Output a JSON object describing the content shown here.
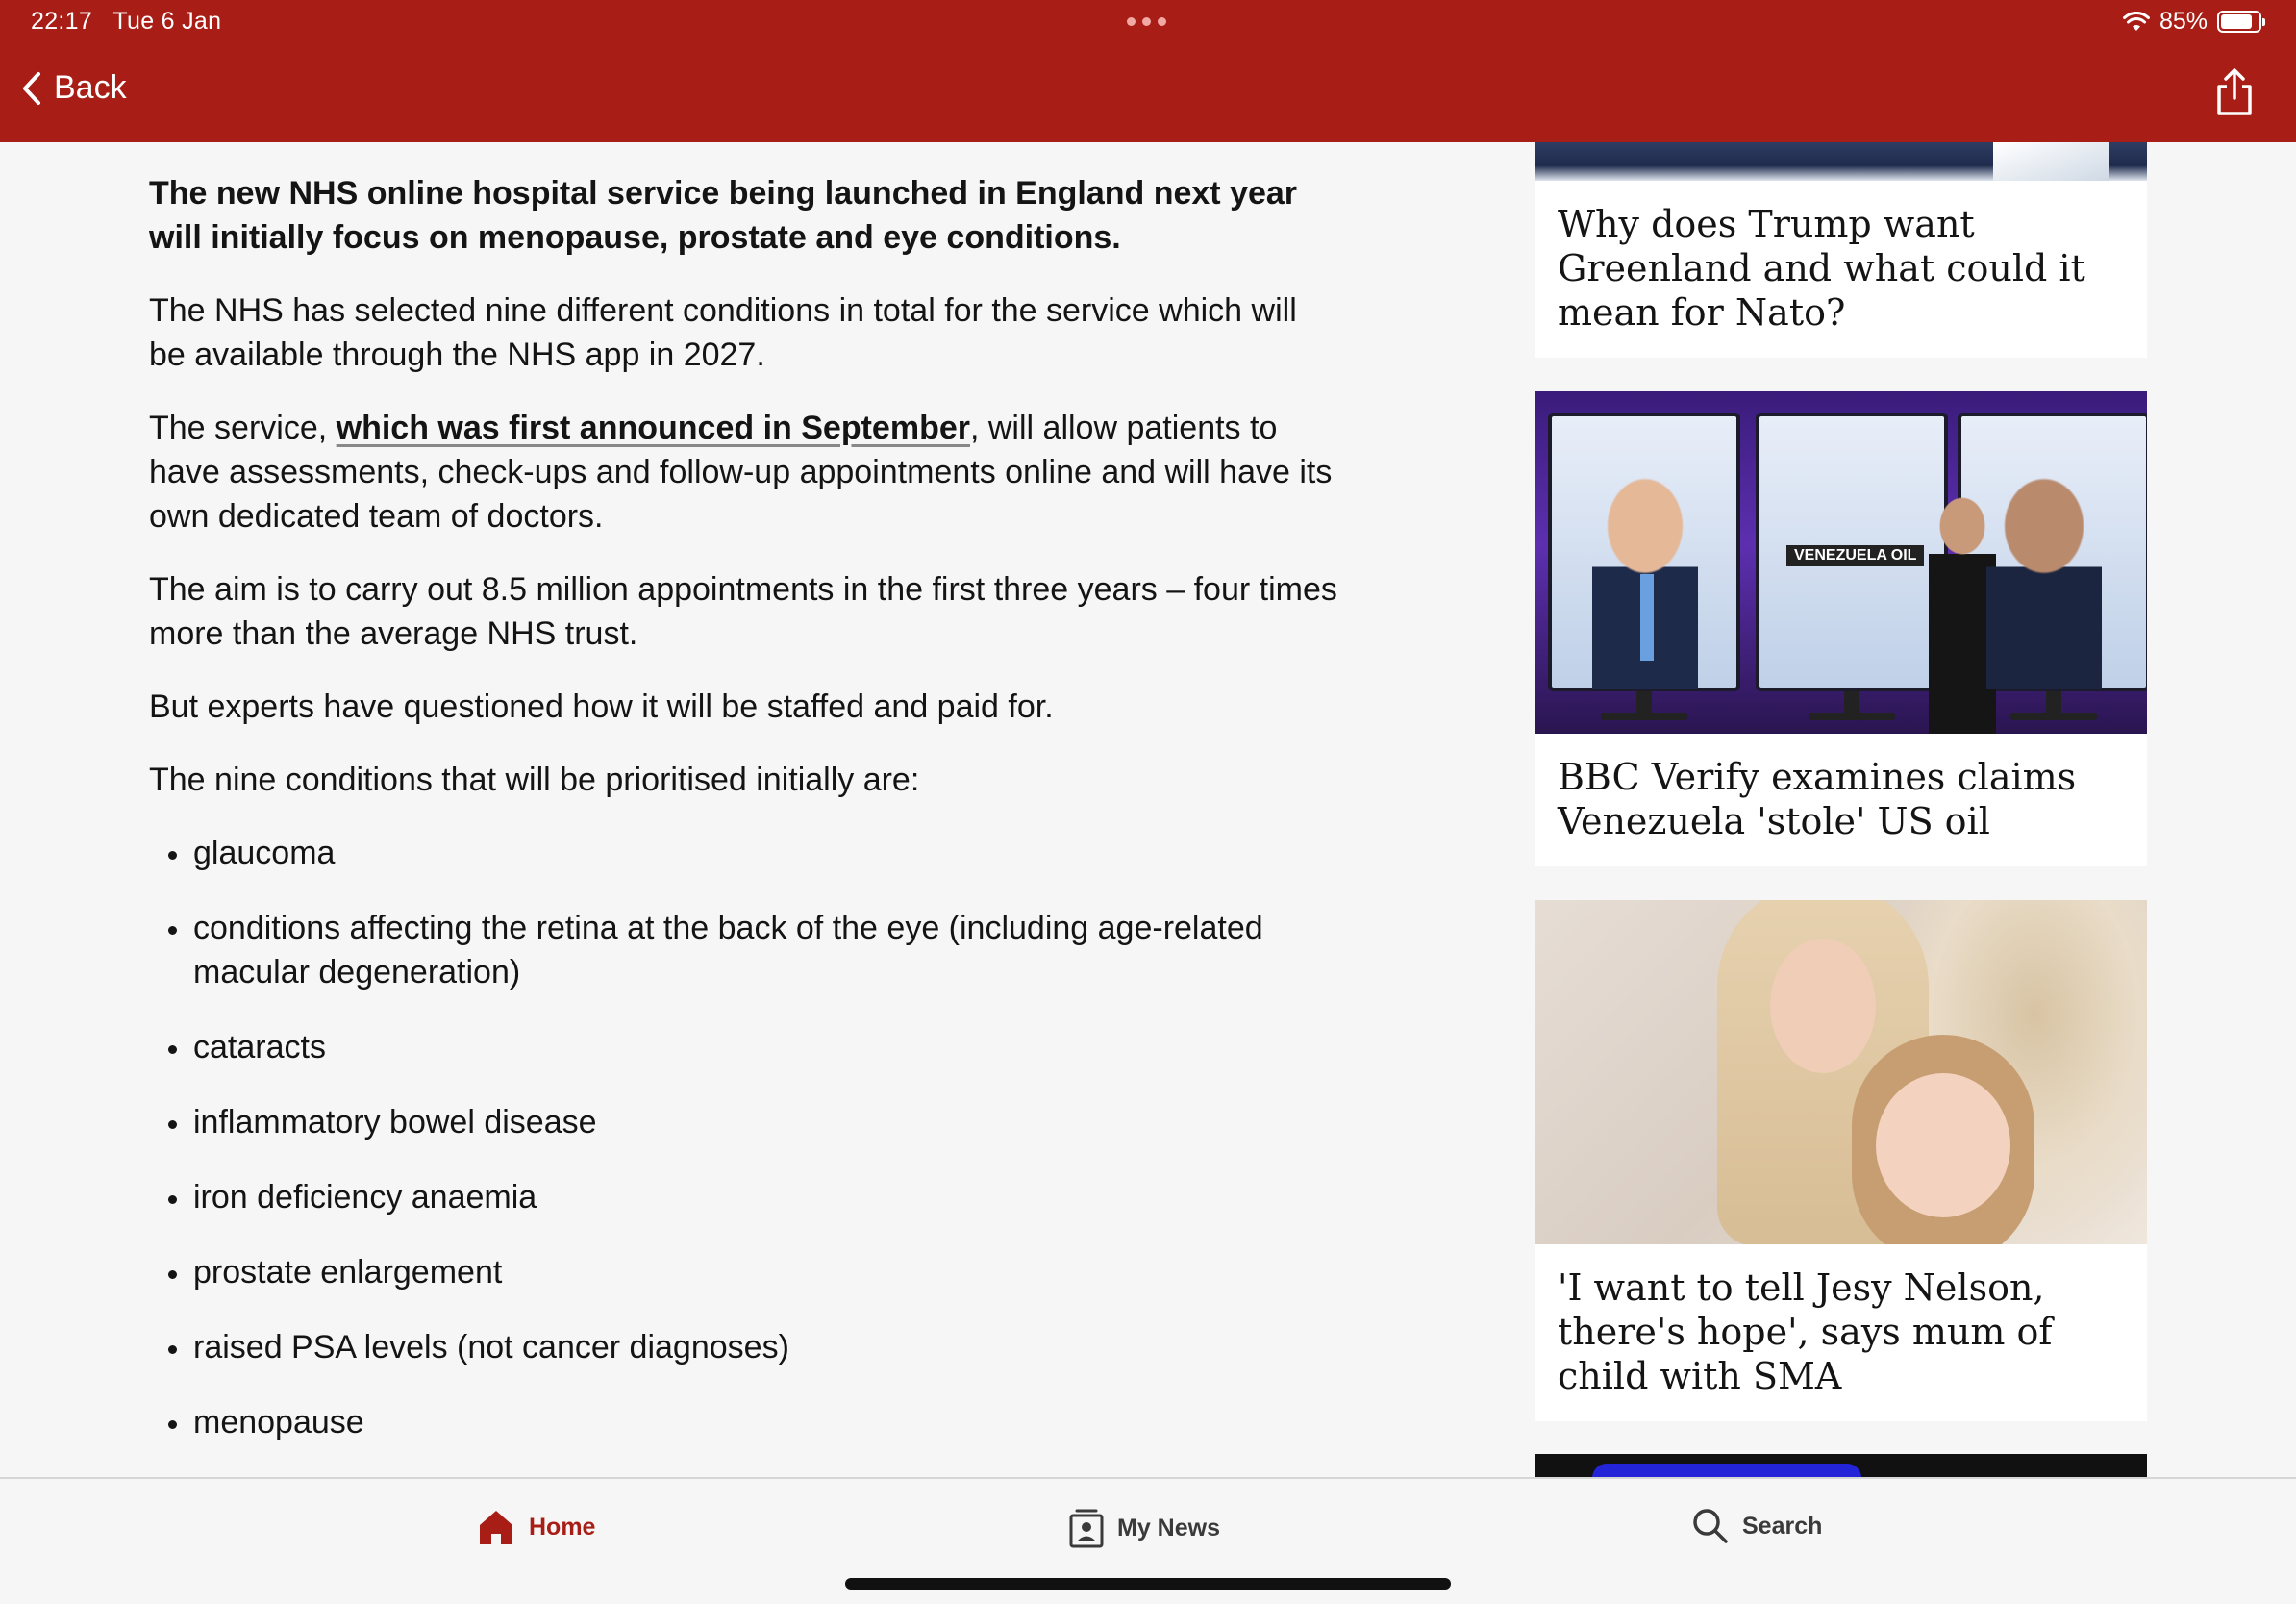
{
  "status_bar": {
    "time": "22:17",
    "date": "Tue 6 Jan",
    "battery": "85%",
    "battery_level": 0.85
  },
  "header": {
    "back_label": "Back",
    "bg_color": "#a81e16"
  },
  "article": {
    "lead": "The new NHS online hospital service being launched in England next year will initially focus on menopause, prostate and eye conditions.",
    "p1": "The NHS has selected nine different conditions in total for the service which will be available through the NHS app in 2027.",
    "p2_before": "The service, ",
    "p2_link": "which was first announced in September",
    "p2_after": ", will allow patients to have assessments, check-ups and follow-up appointments online and will have its own dedicated team of doctors.",
    "p3": "The aim is to carry out 8.5 million appointments in the first three years – four times more than the average NHS trust.",
    "p4": "But experts have questioned how it will be staffed and paid for.",
    "p5": "The nine conditions that will be prioritised initially are:",
    "conditions": [
      "glaucoma",
      "conditions affecting the retina at the back of the eye (including age-related macular degeneration)",
      "cataracts",
      "inflammatory bowel disease",
      "iron deficiency anaemia",
      "prostate enlargement",
      "raised PSA levels (not cancer diagnoses)",
      "menopause"
    ]
  },
  "sidebar": {
    "cards": [
      {
        "title": "Why does Trump want Greenland and what could it mean for Nato?"
      },
      {
        "title": "BBC Verify examines claims Venezuela 'stole' US oil",
        "image_label": "VENEZUELA OIL"
      },
      {
        "title": "'I want to tell Jesy Nelson, there's hope', says mum of child with SMA"
      }
    ]
  },
  "bottom_nav": {
    "items": [
      {
        "label": "Home",
        "icon": "home-icon",
        "active": true
      },
      {
        "label": "My News",
        "icon": "my-news-icon",
        "active": false
      },
      {
        "label": "Search",
        "icon": "search-icon",
        "active": false
      }
    ],
    "active_color": "#a81e16"
  }
}
